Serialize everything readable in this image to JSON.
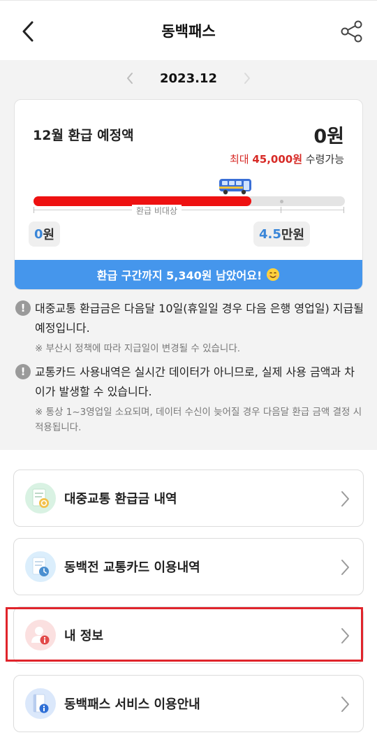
{
  "header": {
    "title": "동백패스",
    "back_icon": "back-chevron-icon",
    "share_icon": "share-icon"
  },
  "month_nav": {
    "label": "2023.12",
    "prev_icon": "chevron-left-icon",
    "next_icon": "chevron-right-icon"
  },
  "refund_card": {
    "label": "12월 환급 예정액",
    "amount": "0원",
    "max_prefix": "최대",
    "max_amount": "45,000원",
    "max_suffix": "수령가능",
    "progress_fraction": 0.7,
    "bus_icon": "bus-icon",
    "scale_note": "환급 비대상",
    "left_value_num": "0",
    "left_value_unit": "원",
    "right_value_num": "4.5",
    "right_value_unit": "만원",
    "banner": "환급 구간까지 5,340원 남았어요!",
    "colors": {
      "progress": "#ee1111",
      "banner": "#4596ec",
      "max_amount": "#d72a26",
      "value_num": "#3a86d8"
    }
  },
  "notices": [
    {
      "icon": "exclamation-icon",
      "main": "대중교통 환급금은 다음달 10일(휴일일 경우 다음 은행 영업일) 지급될 예정입니다.",
      "sub": "※ 부산시 정책에 따라 지급일이 변경될 수 있습니다."
    },
    {
      "icon": "exclamation-icon",
      "main": "교통카드 사용내역은 실시간 데이터가 아니므로, 실제 사용 금액과 차이가 발생할 수 있습니다.",
      "sub": "※ 통상 1~3영업일 소요되며, 데이터 수신이 늦어질 경우 다음달 환급 금액 결정 시 적용됩니다."
    }
  ],
  "menu": [
    {
      "label": "대중교통 환급금 내역",
      "icon": "refund-document-icon"
    },
    {
      "label": "동백전 교통카드 이용내역",
      "icon": "card-history-icon"
    },
    {
      "label": "내 정보",
      "icon": "user-info-icon"
    },
    {
      "label": "동백패스 서비스 이용안내",
      "icon": "service-guide-icon"
    }
  ],
  "highlight_color": "#e0242b"
}
